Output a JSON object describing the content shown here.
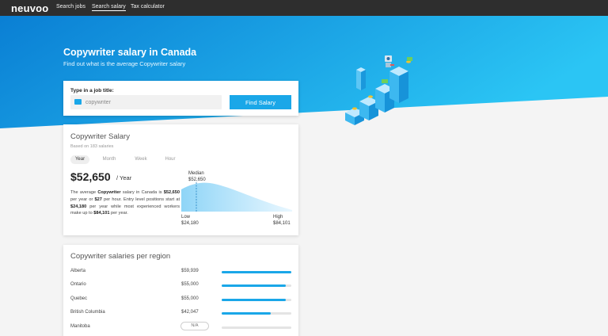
{
  "nav": {
    "logo": "neuvoo",
    "links": [
      {
        "label": "Search jobs",
        "active": false
      },
      {
        "label": "Search salary",
        "active": true
      },
      {
        "label": "Tax calculator",
        "active": false
      }
    ]
  },
  "hero": {
    "title": "Copywriter salary in Canada",
    "subtitle": "Find out what is the average Copywriter salary"
  },
  "search": {
    "label": "Type in a job title:",
    "value": "",
    "placeholder": "copywriter",
    "button_label": "Find Salary",
    "icon": "briefcase-icon"
  },
  "salary": {
    "title": "Copywriter Salary",
    "based_on": "Based on 183 salaries",
    "tabs": [
      {
        "label": "Year",
        "active": true
      },
      {
        "label": "Month",
        "active": false
      },
      {
        "label": "Week",
        "active": false
      },
      {
        "label": "Hour",
        "active": false
      }
    ],
    "amount": "$52,650",
    "period": "/ Year",
    "description": {
      "t1": "The average ",
      "b1": "Copywriter",
      "t2": " salary in Canada is ",
      "b2": "$52,650",
      "t3": " per year or ",
      "b3": "$27",
      "t4": " per hour. Entry level positions start at ",
      "b4": "$24,180",
      "t5": " per year while most experienced workers make up to ",
      "b5": "$84,101",
      "t6": " per year."
    },
    "distribution": {
      "median_label": "Median",
      "median_value": "$52,650",
      "low_label": "Low",
      "low_value": "$24,180",
      "high_label": "High",
      "high_value": "$84,101"
    }
  },
  "regions": {
    "title": "Copywriter salaries per region",
    "rows": [
      {
        "name": "Alberta",
        "value": "$59,939",
        "level": 1.0
      },
      {
        "name": "Ontario",
        "value": "$55,000",
        "level": 0.92
      },
      {
        "name": "Quebec",
        "value": "$55,000",
        "level": 0.92
      },
      {
        "name": "British Columbia",
        "value": "$42,047",
        "level": 0.7
      },
      {
        "name": "Manitoba",
        "value": "N/A",
        "level": 0
      }
    ]
  },
  "colors": {
    "accent": "#1aa7e8",
    "nav_bg": "#2e2e2e",
    "hero_dark": "#0d83d6",
    "hero_light": "#2bc2f2"
  }
}
